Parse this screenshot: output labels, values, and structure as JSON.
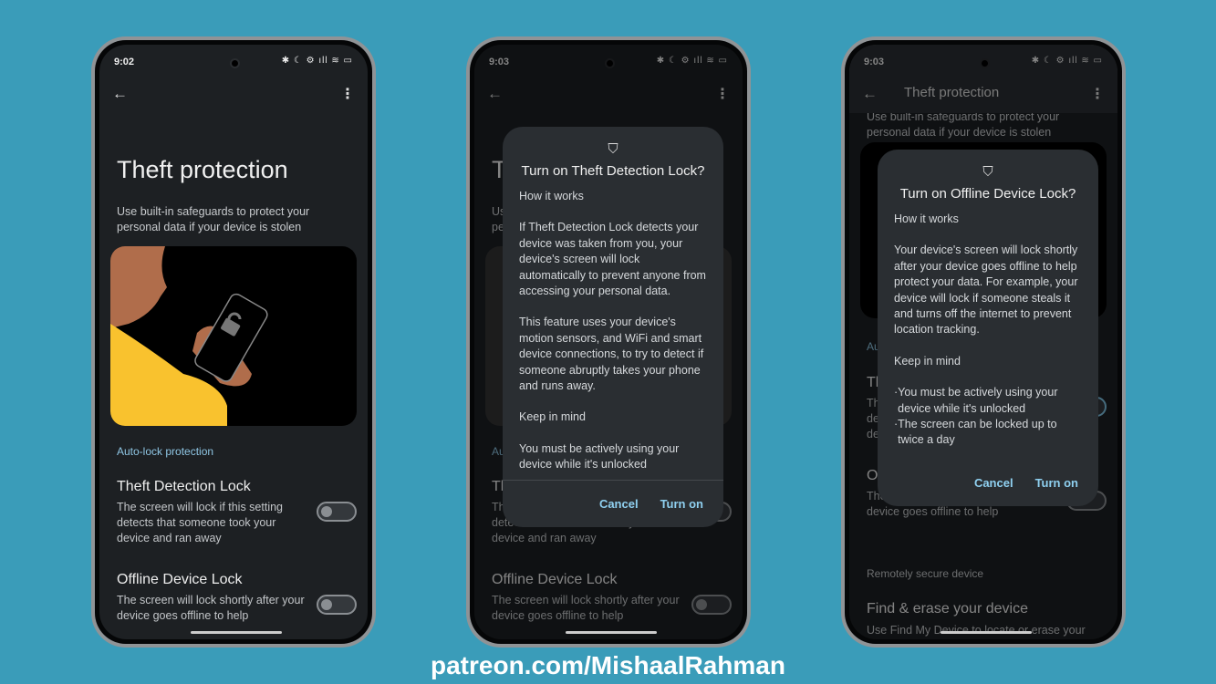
{
  "colors": {
    "background": "#3a9cb9",
    "screen": "#1d2023",
    "dialog": "#2a2e32",
    "accent": "#8fc6e4",
    "illustration_yellow": "#f9c22e",
    "illustration_skin": "#b06d4b"
  },
  "status_icons": [
    "bluetooth-icon",
    "moon-icon",
    "data-saver-icon",
    "signal-icon",
    "wifi-icon",
    "battery-icon"
  ],
  "status_text": "✱ ☾ ⚙ ıll ≋ ▭",
  "page": {
    "title": "Theft protection",
    "subtitle": "Use built-in safeguards to protect your personal data if your device is stolen",
    "section": "Auto-lock protection",
    "items": [
      {
        "title": "Theft Detection Lock",
        "desc": "The screen will lock if this setting detects that someone took your device and ran away"
      },
      {
        "title": "Offline Device Lock",
        "desc": "The screen will lock shortly after your device goes offline to help"
      }
    ],
    "section2": "Remotely secure device",
    "item3_title": "Find & erase your device",
    "item3_desc": "Use Find My Device to locate or erase your"
  },
  "phones": [
    {
      "time": "9:02"
    },
    {
      "time": "9:03",
      "dialog": {
        "title": "Turn on Theft Detection Lock?",
        "h1": "How it works",
        "p1": "If Theft Detection Lock detects your device was taken from you, your device's screen will lock automatically to prevent anyone from accessing your personal data.",
        "p2": "This feature uses your device's motion sensors, and WiFi and smart device connections, to try to detect if someone abruptly takes your phone and runs away.",
        "h2": "Keep in mind",
        "p3": "You must be actively using your device while it's unlocked",
        "cancel": "Cancel",
        "confirm": "Turn on"
      }
    },
    {
      "time": "9:03",
      "header_title": "Theft protection",
      "dialog": {
        "title": "Turn on Offline Device Lock?",
        "h1": "How it works",
        "p1": "Your device's screen will lock shortly after your device goes offline to help protect your data. For example, your device will lock if someone steals it and turns off the internet to prevent location tracking.",
        "h2": "Keep in mind",
        "b1": "You must be actively using your device while it's unlocked",
        "b2": "The screen can be locked up to twice a day",
        "cancel": "Cancel",
        "confirm": "Turn on"
      },
      "toggles_on": [
        true,
        false
      ]
    }
  ],
  "footer": "patreon.com/MishaalRahman"
}
